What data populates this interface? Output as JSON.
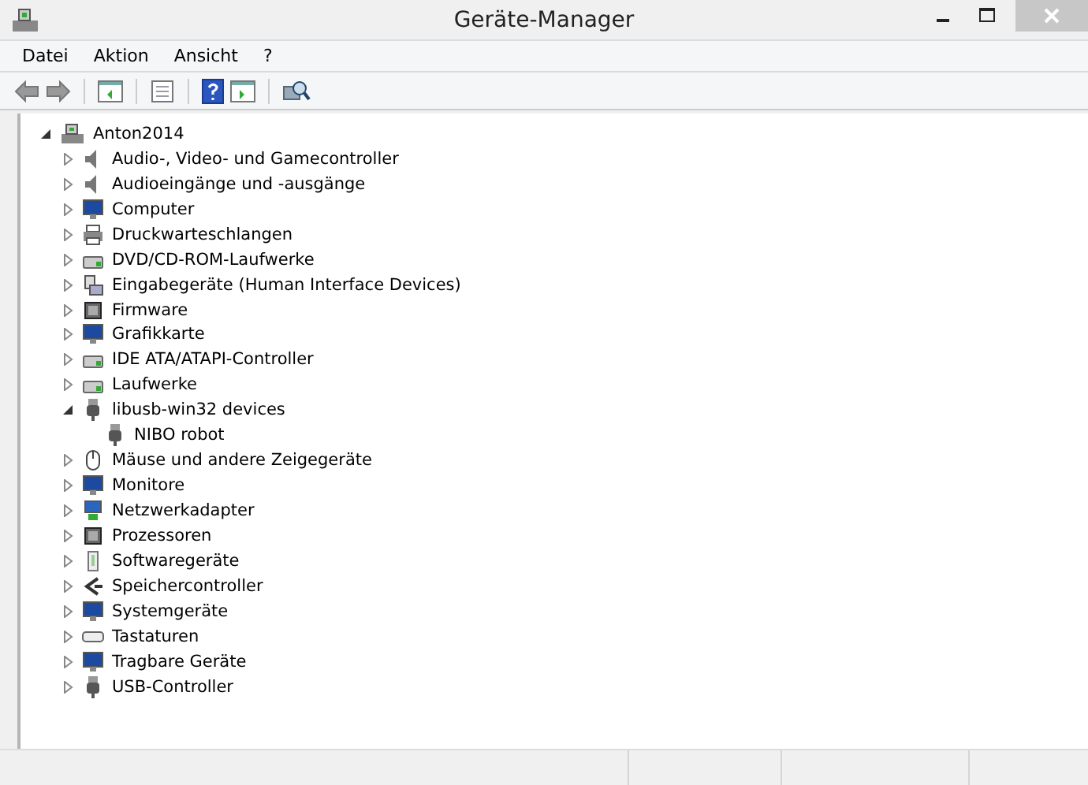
{
  "window": {
    "title": "Geräte-Manager"
  },
  "menu": [
    "Datei",
    "Aktion",
    "Ansicht",
    "?"
  ],
  "tree": {
    "label": "Anton2014",
    "expanded": true,
    "children": [
      {
        "label": "Audio-, Video- und Gamecontroller",
        "expanded": false
      },
      {
        "label": "Audioeingänge und -ausgänge",
        "expanded": false
      },
      {
        "label": "Computer",
        "expanded": false
      },
      {
        "label": "Druckwarteschlangen",
        "expanded": false
      },
      {
        "label": "DVD/CD-ROM-Laufwerke",
        "expanded": false
      },
      {
        "label": "Eingabegeräte (Human Interface Devices)",
        "expanded": false
      },
      {
        "label": "Firmware",
        "expanded": false
      },
      {
        "label": "Grafikkarte",
        "expanded": false
      },
      {
        "label": "IDE ATA/ATAPI-Controller",
        "expanded": false
      },
      {
        "label": "Laufwerke",
        "expanded": false
      },
      {
        "label": "libusb-win32 devices",
        "expanded": true,
        "children": [
          {
            "label": "NIBO robot"
          }
        ]
      },
      {
        "label": "Mäuse und andere Zeigegeräte",
        "expanded": false
      },
      {
        "label": "Monitore",
        "expanded": false
      },
      {
        "label": "Netzwerkadapter",
        "expanded": false
      },
      {
        "label": "Prozessoren",
        "expanded": false
      },
      {
        "label": "Softwaregeräte",
        "expanded": false
      },
      {
        "label": "Speichercontroller",
        "expanded": false
      },
      {
        "label": "Systemgeräte",
        "expanded": false
      },
      {
        "label": "Tastaturen",
        "expanded": false
      },
      {
        "label": "Tragbare Geräte",
        "expanded": false
      },
      {
        "label": "USB-Controller",
        "expanded": false
      }
    ]
  }
}
